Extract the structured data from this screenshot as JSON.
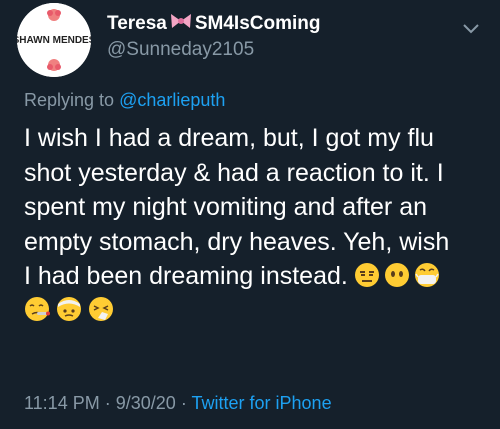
{
  "tweet": {
    "display_name": "Teresa",
    "display_name_suffix": "SM4IsComing",
    "handle": "@Sunneday2105",
    "avatar_text": "SHAWN MENDES",
    "replying_prefix": "Replying to",
    "replying_mention": "@charlieputh",
    "body_lines": [
      "I wish I had a dream, but, I got my flu",
      "shot yesterday & had a reaction to it. I",
      "spent my night vomiting and after an",
      "empty stomach, dry heaves. Yeh, wish",
      "I had been dreaming instead."
    ],
    "inline_emojis": [
      "expressionless-face-emoji",
      "face-without-mouth-emoji",
      "face-with-medical-mask-emoji"
    ],
    "second_row_emojis": [
      "face-with-thermometer-emoji",
      "face-with-head-bandage-emoji",
      "sneezing-face-emoji"
    ],
    "time": "11:14 PM",
    "date": "9/30/20",
    "separator": "·",
    "source": "Twitter for iPhone"
  },
  "colors": {
    "background": "#15202b",
    "secondary_text": "#8899a6",
    "link": "#1da1f2",
    "emoji_yellow": "#ffcc33"
  },
  "icons": [
    "chevron-down-icon",
    "bow-icon"
  ]
}
